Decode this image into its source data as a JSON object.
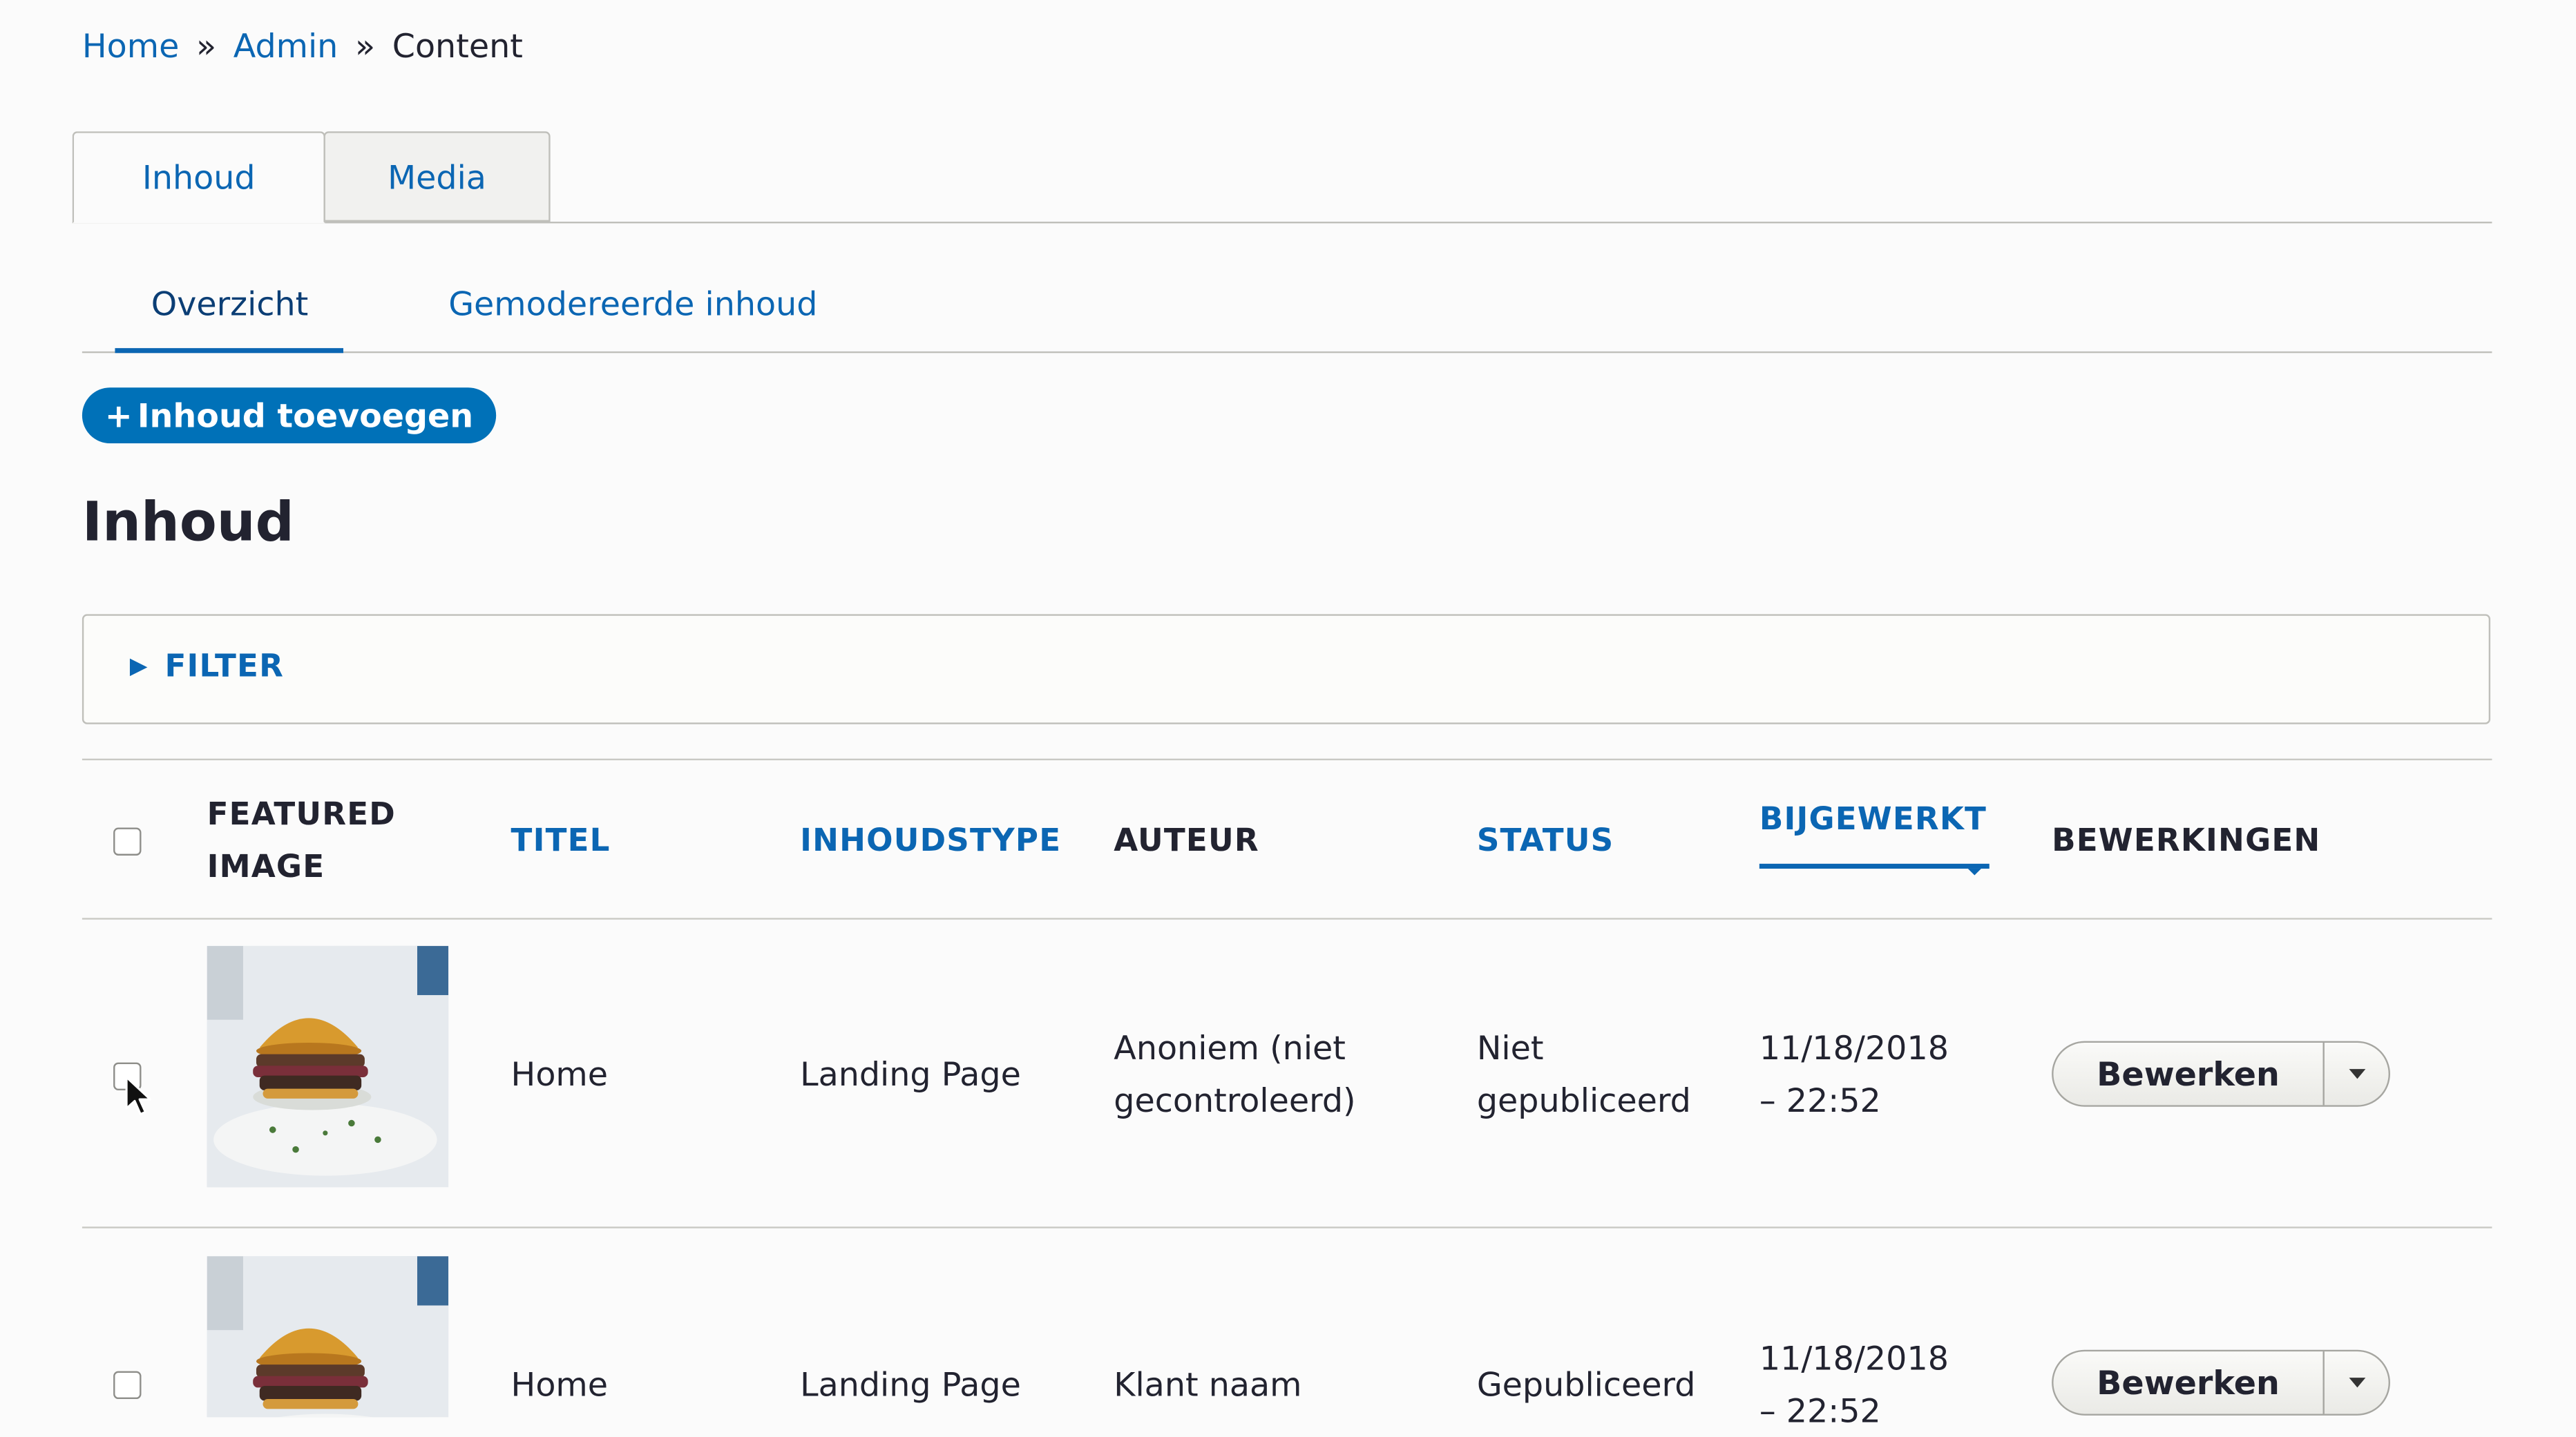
{
  "breadcrumb": {
    "home": "Home",
    "sep1": "»",
    "admin": "Admin",
    "sep2": "»",
    "current": "Content"
  },
  "primary_tabs": [
    {
      "label": "Inhoud",
      "active": true
    },
    {
      "label": "Media",
      "active": false
    }
  ],
  "secondary_tabs": [
    {
      "label": "Overzicht",
      "active": true
    },
    {
      "label": "Gemodereerde inhoud",
      "active": false
    }
  ],
  "add_button": {
    "icon": "+",
    "label": "Inhoud toevoegen"
  },
  "page_title": "Inhoud",
  "filter": {
    "icon": "▶",
    "label": "FILTER"
  },
  "table": {
    "headers": {
      "featured_line1": "FEATURED",
      "featured_line2": "IMAGE",
      "title": "TITEL",
      "type": "INHOUDSTYPE",
      "author": "AUTEUR",
      "status": "STATUS",
      "updated": "BIJGEWERKT",
      "operations": "BEWERKINGEN"
    },
    "sorted_by": "BIJGEWERKT",
    "rows": [
      {
        "title": "Home",
        "type": "Landing Page",
        "author_line1": "Anoniem (niet",
        "author_line2": "gecontroleerd)",
        "author_is_link": false,
        "status_line1": "Niet",
        "status_line2": "gepubliceerd",
        "updated_line1": "11/18/2018",
        "updated_line2": "– 22:52",
        "operation": "Bewerken"
      },
      {
        "title": "Home",
        "type": "Landing Page",
        "author_line1": "Klant naam",
        "author_line2": "",
        "author_is_link": true,
        "status_line1": "Gepubliceerd",
        "status_line2": "",
        "updated_line1": "11/18/2018",
        "updated_line2": "– 22:52",
        "operation": "Bewerken"
      }
    ]
  },
  "colors": {
    "link": "#0b66b3",
    "primary_button": "#0071b8",
    "text": "#222330",
    "border": "#bfbfba"
  }
}
